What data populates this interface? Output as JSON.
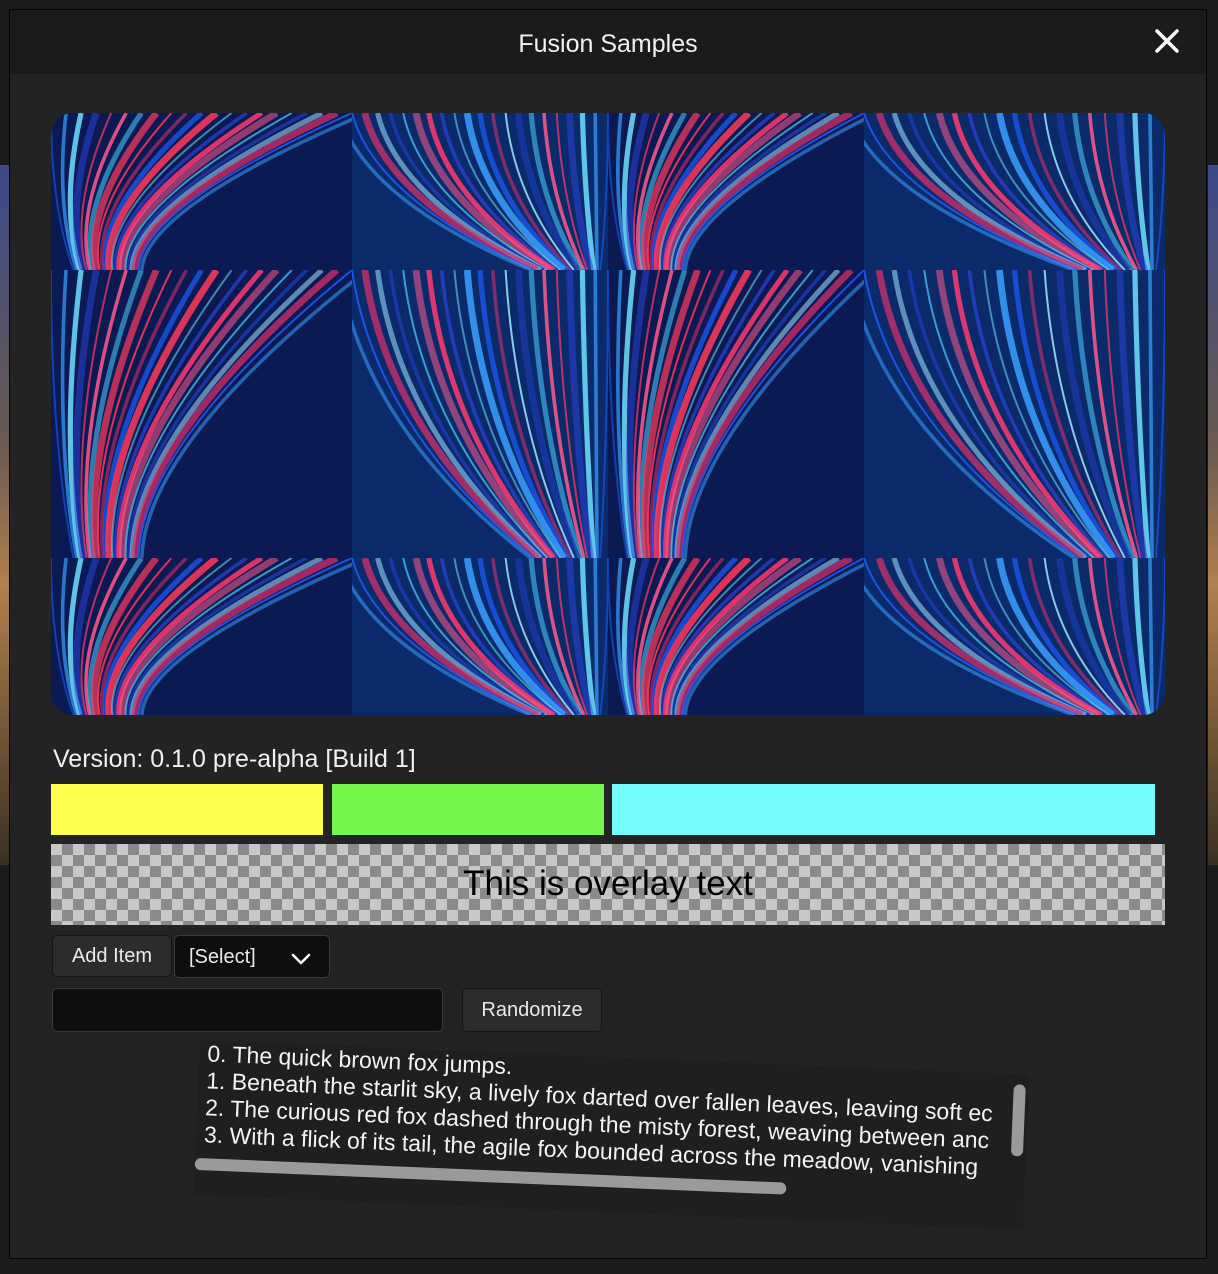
{
  "window": {
    "title": "Fusion Samples",
    "close_icon": "close-icon"
  },
  "image_grid": {
    "description_icon": "light-trails-image-tiles",
    "rows": 3,
    "cols": 4
  },
  "version_text": "Version: 0.1.0 pre-alpha [Build 1]",
  "color_bars": [
    {
      "name": "yellow",
      "color": "#ffff4d"
    },
    {
      "name": "green",
      "color": "#74f74d"
    },
    {
      "name": "cyan",
      "color": "#73fcfd"
    }
  ],
  "overlay": {
    "text": "This is overlay text"
  },
  "controls": {
    "add_item_label": "Add Item",
    "select_value": "[Select]",
    "text_input_value": "",
    "randomize_label": "Randomize"
  },
  "list": {
    "items": [
      "0. The quick brown fox jumps.",
      "1. Beneath the starlit sky, a lively fox darted over fallen leaves, leaving soft ec",
      "2. The curious red fox dashed through the misty forest, weaving between anc",
      "3. With a flick of its tail, the agile fox bounded across the meadow, vanishing"
    ]
  },
  "colors": {
    "window_bg": "#232323",
    "titlebar_bg": "#1b1b1b",
    "text": "#f0f0f0"
  }
}
